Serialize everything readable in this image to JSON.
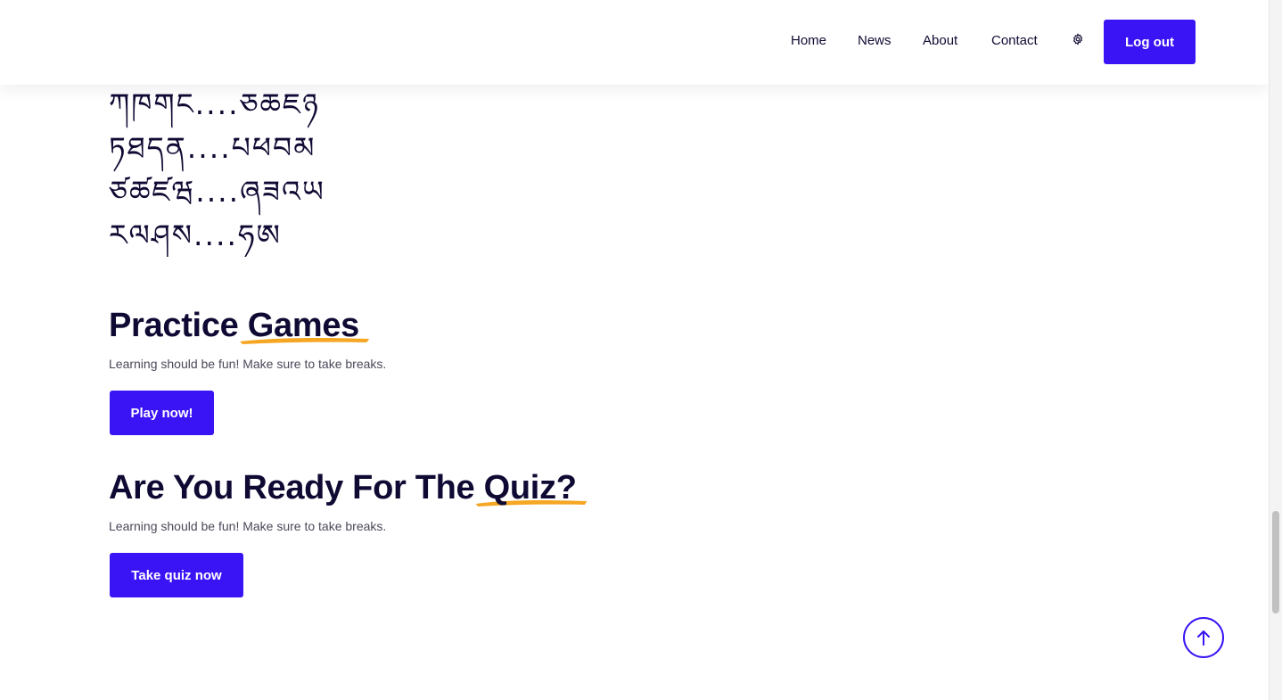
{
  "nav": {
    "items": [
      {
        "label": "Home"
      },
      {
        "label": "News"
      },
      {
        "label": "About"
      },
      {
        "label": "Contact"
      }
    ],
    "settings_icon": "gear-icon",
    "logout_label": "Log out"
  },
  "alphabet": {
    "rows": [
      "ཀཁགང....ཅཆཇཉ",
      "ཏཐདན....པཕབམ",
      "ཙཚཛཝ....ཞཟའཡ",
      "རལཤས....ཧཨ"
    ]
  },
  "games": {
    "title_plain": "Practice ",
    "title_highlight": "Games",
    "description": "Learning should be fun! Make sure to take breaks.",
    "button_label": "Play now!"
  },
  "quiz": {
    "title_plain": "Are You Ready For The ",
    "title_highlight": "Quiz?",
    "description": "Learning should be fun! Make sure to take breaks.",
    "button_label": "Take quiz now"
  },
  "scroll_top": {
    "icon": "arrow-up-icon"
  },
  "colors": {
    "accent": "#3a14f5",
    "highlight_brush": "#f5a623",
    "heading": "#0f0a33"
  }
}
